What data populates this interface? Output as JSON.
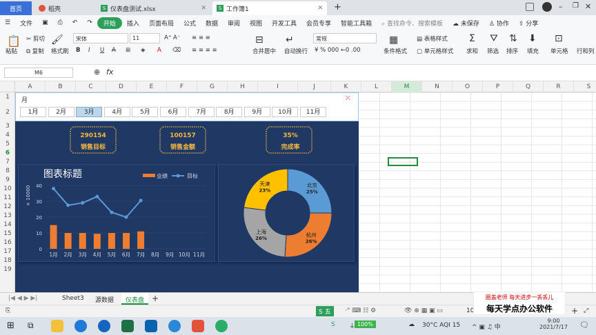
{
  "titlebar": {
    "tabs": [
      {
        "label": "首页",
        "kind": "home"
      },
      {
        "label": "稻壳",
        "kind": "docer"
      },
      {
        "label": "仪表盘测试.xlsx",
        "kind": "sheet"
      },
      {
        "label": "工作簿1",
        "kind": "sheet",
        "active": true
      }
    ],
    "new_tab": "+"
  },
  "menubar": {
    "file": "文件",
    "items": [
      "开始",
      "插入",
      "页面布局",
      "公式",
      "数据",
      "审阅",
      "视图",
      "开发工具",
      "会员专享",
      "智能工具箱"
    ],
    "search_placeholder": "查找命令、搜索模板",
    "unsaved": "未保存",
    "collab": "协作",
    "share": "分享"
  },
  "ribbon": {
    "paste": "粘贴",
    "cut": "剪切",
    "copy": "复制",
    "format_painter": "格式刷",
    "font_name": "宋体",
    "font_size": "11",
    "merge": "合并居中",
    "wrap": "自动换行",
    "number_format": "常规",
    "cond_format": "条件格式",
    "table_style": "表格样式",
    "cell_style": "单元格样式",
    "sum": "求和",
    "filter": "筛选",
    "sort": "排序",
    "fill": "填充",
    "cell": "单元格",
    "rowcol": "行和列"
  },
  "formula_bar": {
    "cell_ref": "M6",
    "fx": "fx",
    "value": ""
  },
  "columns": [
    "A",
    "B",
    "C",
    "D",
    "E",
    "F",
    "G",
    "H",
    "I",
    "J",
    "K",
    "L",
    "M",
    "N",
    "O",
    "P",
    "Q",
    "R",
    "S"
  ],
  "rows": [
    "1",
    "2",
    "3",
    "4",
    "5",
    "6",
    "7",
    "8",
    "9",
    "10",
    "11",
    "12",
    "13",
    "14",
    "15",
    "16",
    "17",
    "18",
    "19"
  ],
  "slicer": {
    "title": "月",
    "months": [
      "1月",
      "2月",
      "3月",
      "4月",
      "5月",
      "6月",
      "7月",
      "8月",
      "9月",
      "10月",
      "11月"
    ],
    "selected": "3月"
  },
  "kpis": [
    {
      "value": "290154",
      "label": "销售目标"
    },
    {
      "value": "100157",
      "label": "销售金额"
    },
    {
      "value": "35%",
      "label": "完成率"
    }
  ],
  "colors": {
    "dashboard_bg": "#1f3864",
    "gold": "#f5b942",
    "bar": "#ed7d31",
    "line": "#5b9bd5"
  },
  "chart_data": [
    {
      "type": "bar",
      "title": "图表标题",
      "ylabel": "× 10000",
      "categories": [
        "1月",
        "2月",
        "3月",
        "4月",
        "5月",
        "6月",
        "7月",
        "8月",
        "9月",
        "10月",
        "11月"
      ],
      "ylim": [
        0,
        40
      ],
      "yticks": [
        "0",
        "10",
        "20",
        "30",
        "40"
      ],
      "series": [
        {
          "name": "业绩",
          "type": "bar",
          "values": [
            15,
            10,
            10,
            9.5,
            10,
            10,
            11,
            null,
            null,
            null,
            null
          ]
        },
        {
          "name": "目标",
          "type": "line",
          "values": [
            38,
            27.5,
            29,
            33,
            23,
            20,
            30.5,
            null,
            null,
            null,
            null
          ]
        }
      ],
      "legend": "top-right"
    },
    {
      "type": "pie",
      "variant": "doughnut",
      "slices": [
        {
          "label": "北京",
          "pct": "25%",
          "value": 25,
          "color": "#5b9bd5"
        },
        {
          "label": "杭州",
          "pct": "26%",
          "value": 26,
          "color": "#ed7d31"
        },
        {
          "label": "上海",
          "pct": "26%",
          "value": 26,
          "color": "#a5a5a5"
        },
        {
          "label": "天津",
          "pct": "23%",
          "value": 23,
          "color": "#ffc000"
        }
      ]
    }
  ],
  "sheets": [
    "Sheet3",
    "源数据",
    "仪表盘"
  ],
  "active_sheet": "仪表盘",
  "status": {
    "ime": "五",
    "zoom": "10",
    "watermark_top": "圈盖老师 每天进步一丢丢儿",
    "watermark_main": "每天学点办公软件"
  },
  "taskbar": {
    "battery": "100%",
    "weather": "30°C AQI 15",
    "time": "9:00",
    "date": "2021/7/17"
  }
}
